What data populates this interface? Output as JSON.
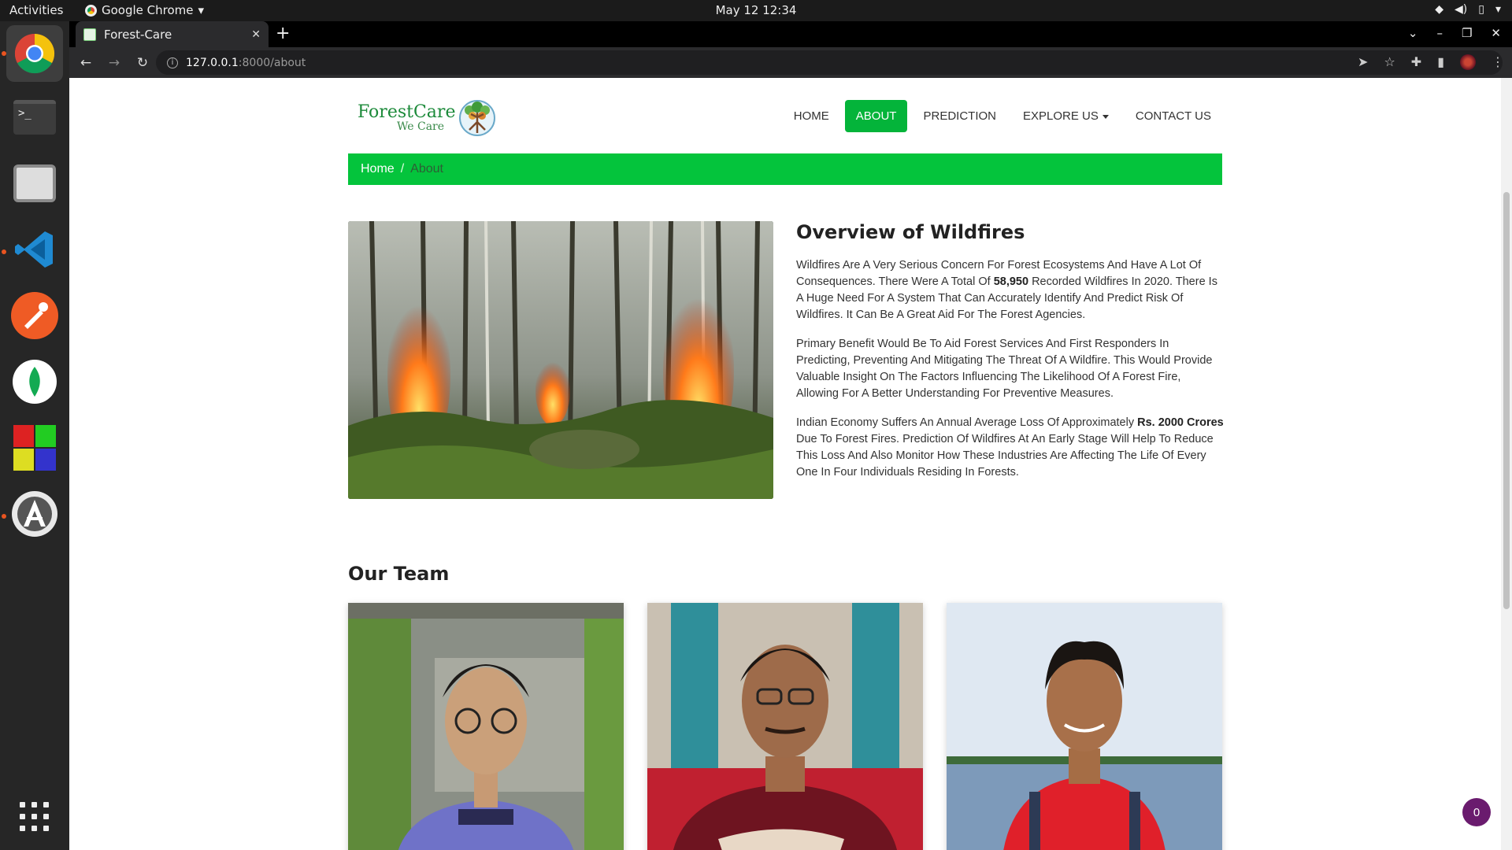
{
  "system_bar": {
    "activities": "Activities",
    "app_name": "Google Chrome",
    "clock": "May 12  12:34"
  },
  "browser": {
    "tab_title": "Forest-Care",
    "url_host": "127.0.0.1",
    "url_path": ":8000/about"
  },
  "site": {
    "logo_line1": "ForestCare",
    "logo_line2": "We Care",
    "nav": {
      "home": "HOME",
      "about": "ABOUT",
      "prediction": "PREDICTION",
      "explore": "EXPLORE US",
      "contact": "CONTACT US"
    },
    "breadcrumb": {
      "home": "Home",
      "separator": "/",
      "current": "About"
    },
    "overview": {
      "title": "Overview of Wildfires",
      "p1_a": "Wildfires Are A Very Serious Concern For Forest Ecosystems And Have A Lot Of Consequences. There Were A Total Of ",
      "p1_b": "58,950",
      "p1_c": " Recorded Wildfires In 2020. There Is A Huge Need For A System That Can Accurately Identify And Predict Risk Of Wildfires. It Can Be A Great Aid For The Forest Agencies.",
      "p2": "Primary Benefit Would Be To Aid Forest Services And First Responders In Predicting, Preventing And Mitigating The Threat Of A Wildfire. This Would Provide Valuable Insight On The Factors Influencing The Likelihood Of A Forest Fire, Allowing For A Better Understanding For Preventive Measures.",
      "p3_a": "Indian Economy Suffers An Annual Average Loss Of Approximately ",
      "p3_b": "Rs. 2000 Crores",
      "p3_c": " Due To Forest Fires. Prediction Of Wildfires At An Early Stage Will Help To Reduce This Loss And Also Monitor How These Industries Are Affecting The Life Of Every One In Four Individuals Residing In Forests."
    },
    "team_title": "Our Team",
    "notification_count": "0"
  },
  "colors": {
    "accent_green": "#04c43c",
    "nav_active": "#04b43a",
    "badge": "#6a1b6e"
  },
  "icons": [
    "chrome-icon",
    "terminal-icon",
    "files-icon",
    "vscode-icon",
    "postman-icon",
    "mongodb-icon",
    "app-grid-icon",
    "software-icon",
    "show-apps-icon"
  ]
}
